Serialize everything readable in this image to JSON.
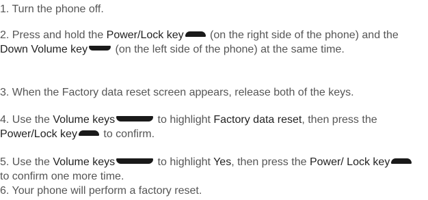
{
  "steps": [
    {
      "num": "1.",
      "parts": [
        {
          "t": "text",
          "v": " Turn the phone off."
        }
      ]
    },
    {
      "num": "2.",
      "parts": [
        {
          "t": "text",
          "v": " Press and hold the "
        },
        {
          "t": "kw",
          "v": "Power/Lock key"
        },
        {
          "t": "key",
          "icon": "power-lock-key-icon"
        },
        {
          "t": "text",
          "v": " (on the right side of the phone) and the "
        },
        {
          "t": "kw",
          "v": "Down Volume key"
        },
        {
          "t": "key",
          "icon": "down-volume-key-icon"
        },
        {
          "t": "text",
          "v": " (on the left side of the phone) at the same time."
        }
      ]
    },
    {
      "num": "3.",
      "parts": [
        {
          "t": "text",
          "v": " When the Factory data reset screen appears, release both of the keys."
        }
      ]
    },
    {
      "num": "4.",
      "parts": [
        {
          "t": "text",
          "v": " Use the "
        },
        {
          "t": "kw",
          "v": "Volume keys"
        },
        {
          "t": "key",
          "icon": "volume-keys-icon"
        },
        {
          "t": "text",
          "v": " to highlight "
        },
        {
          "t": "kw",
          "v": "Factory data reset"
        },
        {
          "t": "text",
          "v": ", then press the "
        },
        {
          "t": "kw",
          "v": "Power/Lock key"
        },
        {
          "t": "key",
          "icon": "power-lock-key-icon"
        },
        {
          "t": "text",
          "v": " to confirm."
        }
      ]
    },
    {
      "num": "5.",
      "parts": [
        {
          "t": "text",
          "v": " Use the "
        },
        {
          "t": "kw",
          "v": "Volume keys"
        },
        {
          "t": "key",
          "icon": "volume-keys-icon"
        },
        {
          "t": "text",
          "v": " to highlight "
        },
        {
          "t": "kw",
          "v": "Yes"
        },
        {
          "t": "text",
          "v": ", then press the "
        },
        {
          "t": "kw",
          "v": "Power/ Lock key"
        },
        {
          "t": "key",
          "icon": "power-lock-key-icon"
        },
        {
          "t": "text",
          "v": " to confirm one more time."
        }
      ]
    },
    {
      "num": "6.",
      "parts": [
        {
          "t": "text",
          "v": " Your phone will perform a factory reset."
        }
      ]
    }
  ],
  "colors": {
    "text": "#555555",
    "emphasis": "#222222",
    "key_icon": "#1a1a1a"
  }
}
